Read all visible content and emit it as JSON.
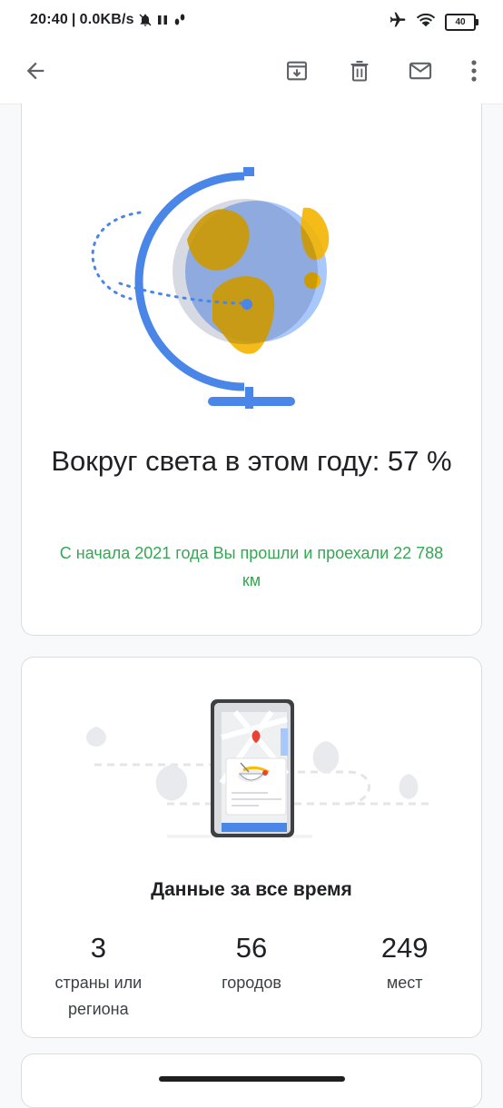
{
  "status_bar": {
    "time": "20:40",
    "network_speed": "0.0KB/s",
    "icons": [
      "bell-off-icon",
      "pause-icon",
      "footsteps-icon",
      "airplane-icon",
      "wifi-icon"
    ],
    "battery": "40"
  },
  "app_bar": {
    "icons": [
      "back-arrow-icon",
      "archive-icon",
      "delete-icon",
      "mail-icon",
      "more-vert-icon"
    ]
  },
  "card_world": {
    "headline": "Вокруг света в этом году: 57 %",
    "subline": "С начала 2021 года Вы прошли и проехали 22 788 км",
    "illustration": "globe-icon",
    "colors": {
      "globe": "#a8c7fa",
      "land": "#f4b400",
      "stand": "#4a86e8",
      "accent_text": "#34a853"
    }
  },
  "card_alltime": {
    "title": "Данные за все время",
    "illustration": "phone-map-icon",
    "stats": [
      {
        "value": "3",
        "label": "страны или региона"
      },
      {
        "value": "56",
        "label": "городов"
      },
      {
        "value": "249",
        "label": "мест"
      }
    ]
  }
}
